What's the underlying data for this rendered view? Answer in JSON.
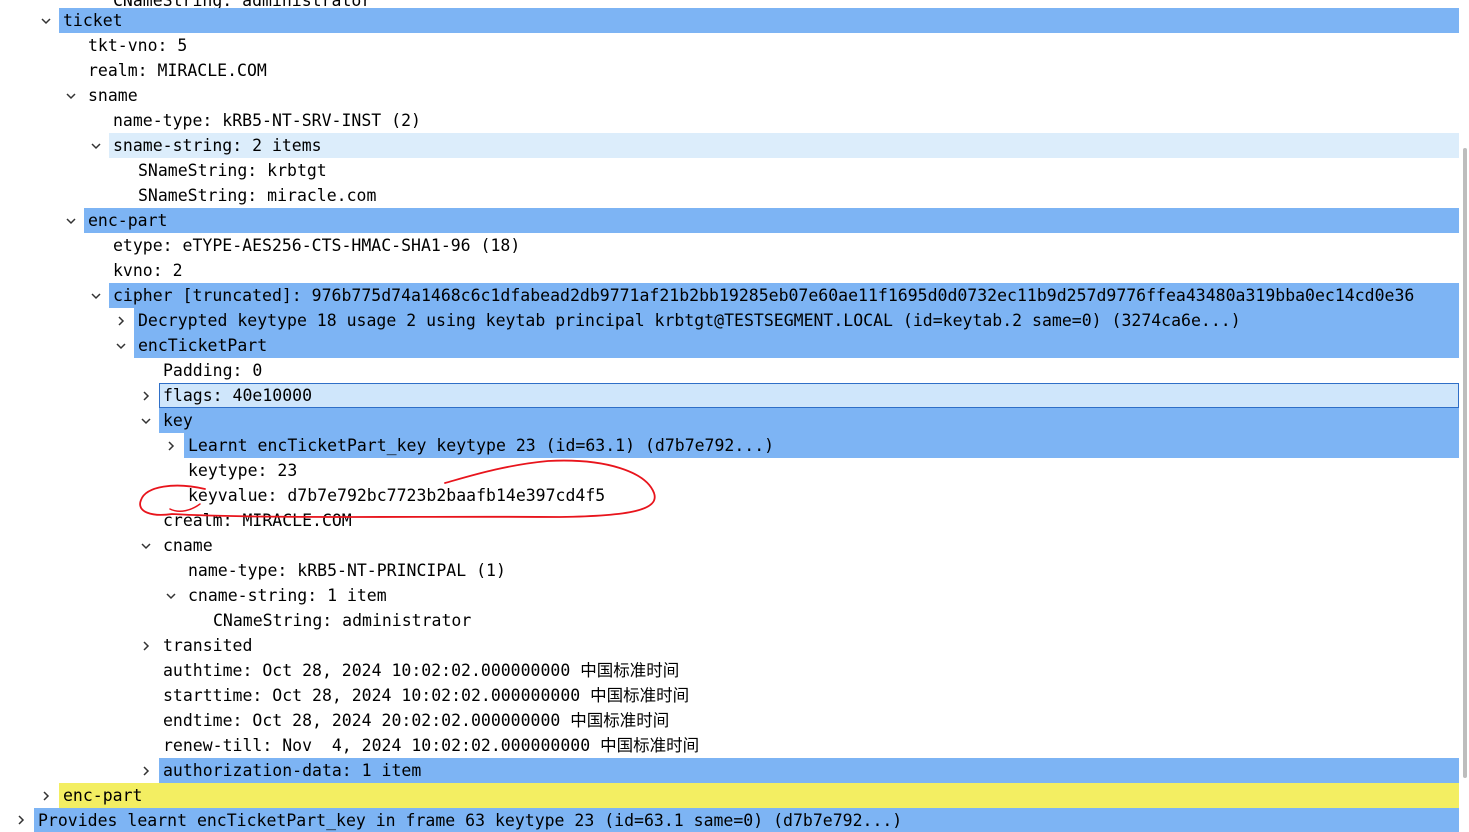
{
  "tree": {
    "rows": [
      {
        "label": "CNameString: administrator"
      },
      {
        "label": "ticket"
      },
      {
        "label": "tkt-vno: 5"
      },
      {
        "label": "realm: MIRACLE.COM"
      },
      {
        "label": "sname"
      },
      {
        "label": "name-type: kRB5-NT-SRV-INST (2)"
      },
      {
        "label": "sname-string: 2 items"
      },
      {
        "label": "SNameString: krbtgt"
      },
      {
        "label": "SNameString: miracle.com"
      },
      {
        "label": "enc-part"
      },
      {
        "label": "etype: eTYPE-AES256-CTS-HMAC-SHA1-96 (18)"
      },
      {
        "label": "kvno: 2"
      },
      {
        "label": "cipher [truncated]: 976b775d74a1468c6c1dfabead2db9771af21b2bb19285eb07e60ae11f1695d0d0732ec11b9d257d9776ffea43480a319bba0ec14cd0e36"
      },
      {
        "label": "Decrypted keytype 18 usage 2 using keytab principal krbtgt@TESTSEGMENT.LOCAL (id=keytab.2 same=0) (3274ca6e...)"
      },
      {
        "label": "encTicketPart"
      },
      {
        "label": "Padding: 0"
      },
      {
        "label": "flags: 40e10000"
      },
      {
        "label": "key"
      },
      {
        "label": "Learnt encTicketPart_key keytype 23 (id=63.1) (d7b7e792...)"
      },
      {
        "label": "keytype: 23"
      },
      {
        "label": "keyvalue: d7b7e792bc7723b2baafb14e397cd4f5"
      },
      {
        "label": "crealm: MIRACLE.COM"
      },
      {
        "label": "cname"
      },
      {
        "label": "name-type: kRB5-NT-PRINCIPAL (1)"
      },
      {
        "label": "cname-string: 1 item"
      },
      {
        "label": "CNameString: administrator"
      },
      {
        "label": "transited"
      },
      {
        "label": "authtime: Oct 28, 2024 10:02:02.000000000 中国标准时间"
      },
      {
        "label": "starttime: Oct 28, 2024 10:02:02.000000000 中国标准时间"
      },
      {
        "label": "endtime: Oct 28, 2024 20:02:02.000000000 中国标准时间"
      },
      {
        "label": "renew-till: Nov  4, 2024 10:02:02.000000000 中国标准时间"
      },
      {
        "label": "authorization-data: 1 item"
      },
      {
        "label": "enc-part"
      },
      {
        "label": "Provides learnt encTicketPart_key in frame 63 keytype 23 (id=63.1 same=0) (d7b7e792...)"
      }
    ]
  },
  "colors": {
    "highlight_blue": "#7db4f4",
    "highlight_light": "#dcedfb",
    "selected": "#cfe6fb",
    "highlight_yellow": "#f3ee62",
    "annotation_red": "#e8141c"
  }
}
